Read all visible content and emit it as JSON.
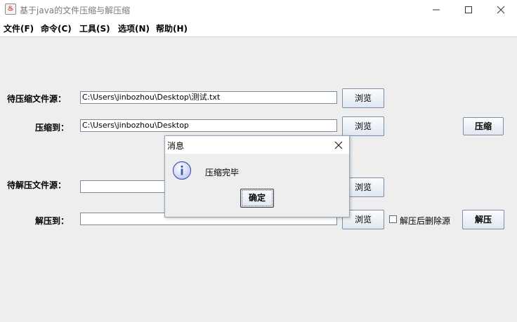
{
  "window": {
    "title": "基于java的文件压缩与解压缩",
    "app_icon": "java-cup-icon",
    "controls": [
      "minimize-icon",
      "maximize-icon",
      "close-icon"
    ]
  },
  "menu": {
    "file": "文件(F)",
    "command": "命令(C)",
    "tools": "工具(S)",
    "options": "选项(N)",
    "help": "帮助(H)"
  },
  "compress": {
    "source_label": "待压缩文件源：",
    "source_value": "C:\\Users\\jinbozhou\\Desktop\\测试.txt",
    "target_label": "压缩到：",
    "target_value": "C:\\Users\\jinbozhou\\Desktop",
    "browse_label": "浏览",
    "action_label": "压缩"
  },
  "decompress": {
    "source_label": "待解压文件源：",
    "source_value": "",
    "target_label": "解压到：",
    "target_value": "",
    "browse_label": "浏览",
    "delete_source_label": "解压后删除源",
    "delete_source_checked": false,
    "action_label": "解压"
  },
  "dialog": {
    "title": "消息",
    "message": "压缩完毕",
    "ok_label": "确定",
    "icon": "info-icon"
  },
  "colors": {
    "background": "#eeeeee",
    "button_border": "#7a8ea6",
    "field_border": "#7a8ba0",
    "info_icon": "#3c58b8"
  }
}
